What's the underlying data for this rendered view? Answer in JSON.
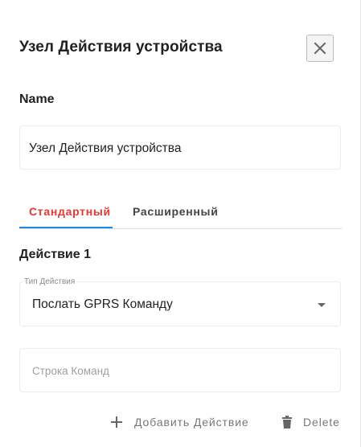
{
  "dialog": {
    "title": "Узел Действия устройства"
  },
  "name_section": {
    "label": "Name",
    "value": "Узел Действия устройства"
  },
  "tabs": [
    {
      "label": "Стандартный",
      "active": true
    },
    {
      "label": "Расширенный",
      "active": false
    }
  ],
  "action": {
    "heading": "Действие 1",
    "type_label": "Тип Действия",
    "type_value": "Послать GPRS Команду",
    "command_placeholder": "Строка Команд"
  },
  "buttons": {
    "add_label": "Добавить Действие",
    "delete_label": "Delete"
  },
  "colors": {
    "active_tab": "#e53935",
    "tab_indicator": "#1e88e5",
    "muted_text": "#777777"
  },
  "icons": {
    "close": "close-icon",
    "add": "plus-icon",
    "delete": "trash-icon",
    "dropdown": "chevron-down-icon"
  }
}
